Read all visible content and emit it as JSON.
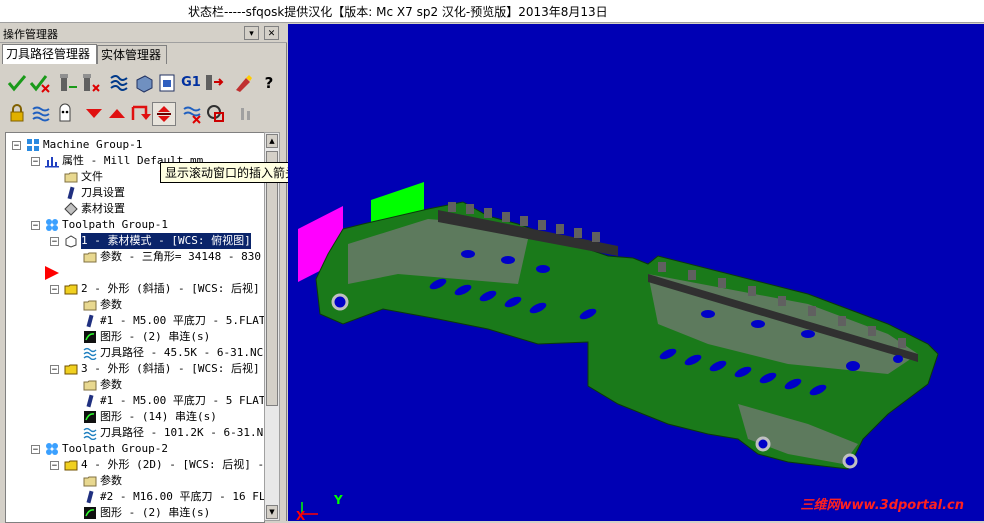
{
  "status_bar": {
    "text": "状态栏-----sfqosk提供汉化【版本: Mc X7 sp2 汉化-预览版】2013年8月13日"
  },
  "panel": {
    "title": "操作管理器",
    "pin_glyph": "▾",
    "close_glyph": "✕",
    "tabs": [
      {
        "label": "刀具路径管理器",
        "active": true
      },
      {
        "label": "实体管理器",
        "active": false
      }
    ]
  },
  "toolbar1_icons": [
    "select-all-ops-icon",
    "select-invalid-ops-icon",
    "regenerate-selected-icon",
    "regenerate-dirty-icon",
    "backplot-icon",
    "verify-icon",
    "simulate-icon",
    "g1-post-icon",
    "high-speed-icon",
    "edit-toolpath-icon",
    "help-icon"
  ],
  "toolbar2_icons": [
    "lock-icon",
    "wave-toggle-icon",
    "display-toggle-icon",
    "move-down-icon",
    "move-up-icon",
    "insert-arrow-icon",
    "scroll-insert-icon",
    "hatch-icon",
    "show-only-icon",
    "disabled-icon"
  ],
  "toolbar1_labels": {
    "g1": "G1",
    "help": "?"
  },
  "tooltip": "显示滚动窗口的插入箭头",
  "tree": [
    {
      "text": "Machine Group-1",
      "icon": "machine-group-icon",
      "indent": 0,
      "expander": "minus"
    },
    {
      "text": "属性 - Mill Default mm",
      "icon": "properties-icon",
      "indent": 1,
      "expander": "minus"
    },
    {
      "text": "文件",
      "icon": "folder-icon",
      "indent": 2
    },
    {
      "text": "刀具设置",
      "icon": "tool-icon",
      "indent": 2
    },
    {
      "text": "素材设置",
      "icon": "stock-icon",
      "indent": 2
    },
    {
      "text": "Toolpath Group-1",
      "icon": "toolpath-group-icon",
      "indent": 1,
      "expander": "minus"
    },
    {
      "text": "1 - 素材模式 - [WCS: 俯视图]",
      "icon": "stock-model-icon",
      "indent": 2,
      "expander": "minus",
      "selected": true
    },
    {
      "text": "参数 - 三角形= 34148 - 830",
      "icon": "folder-icon",
      "indent": 3
    },
    {
      "text": "",
      "icon": "insert-arrow-marker",
      "indent": 1
    },
    {
      "text": "2 - 外形 (斜插) - [WCS: 后视]",
      "icon": "operation-folder-icon",
      "indent": 2,
      "expander": "minus"
    },
    {
      "text": "参数",
      "icon": "folder-icon",
      "indent": 3
    },
    {
      "text": "#1 - M5.00 平底刀 - 5.FLAT",
      "icon": "tool-icon",
      "indent": 3
    },
    {
      "text": "图形 - (2) 串连(s)",
      "icon": "geometry-icon",
      "indent": 3
    },
    {
      "text": "刀具路径 - 45.5K - 6-31.NC",
      "icon": "toolpath-icon",
      "indent": 3
    },
    {
      "text": "3 - 外形 (斜插) - [WCS: 后视]",
      "icon": "operation-folder-icon",
      "indent": 2,
      "expander": "minus"
    },
    {
      "text": "参数",
      "icon": "folder-icon",
      "indent": 3
    },
    {
      "text": "#1 - M5.00 平底刀 - 5 FLAT",
      "icon": "tool-icon",
      "indent": 3
    },
    {
      "text": "图形 - (14) 串连(s)",
      "icon": "geometry-icon",
      "indent": 3
    },
    {
      "text": "刀具路径 - 101.2K - 6-31.NC",
      "icon": "toolpath-icon",
      "indent": 3
    },
    {
      "text": "Toolpath Group-2",
      "icon": "toolpath-group-icon",
      "indent": 1,
      "expander": "minus"
    },
    {
      "text": "4 - 外形 (2D) - [WCS: 后视] -",
      "icon": "operation-folder-icon",
      "indent": 2,
      "expander": "minus"
    },
    {
      "text": "参数",
      "icon": "folder-icon",
      "indent": 3
    },
    {
      "text": "#2 - M16.00 平底刀 - 16 FL",
      "icon": "tool-icon",
      "indent": 3
    },
    {
      "text": "图形 - (2) 串连(s)",
      "icon": "geometry-icon",
      "indent": 3
    }
  ],
  "viewport": {
    "background": "#0000b4",
    "part_color": "#1a7a1a",
    "axis_y": "Y",
    "axis_x": "X",
    "watermark": "三维网www.3dportal.cn"
  }
}
